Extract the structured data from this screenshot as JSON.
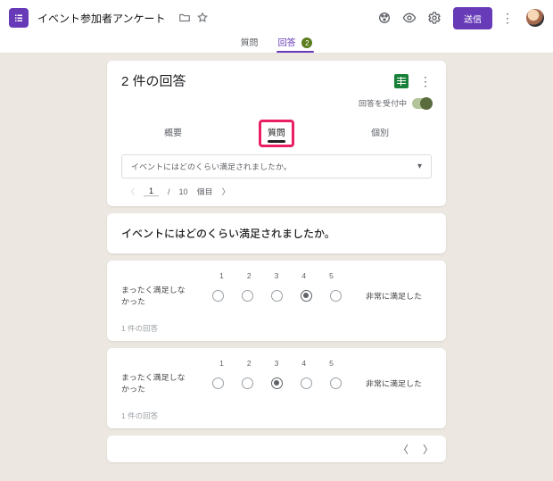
{
  "header": {
    "form_title": "イベント参加者アンケート",
    "send_label": "送信"
  },
  "top_tabs": {
    "questions": "質問",
    "responses": "回答",
    "responses_badge": "2"
  },
  "summary": {
    "title": "2 件の回答",
    "accepting_label": "回答を受付中",
    "inner_tabs": {
      "overview": "概要",
      "question": "質問",
      "individual": "個別"
    },
    "selector_text": "イベントにはどのくらい満足されましたか。",
    "pager": {
      "current": "1",
      "sep": "/",
      "total": "10",
      "unit": "個目"
    }
  },
  "question": {
    "title": "イベントにはどのくらい満足されましたか。"
  },
  "scale": {
    "numbers": [
      "1",
      "2",
      "3",
      "4",
      "5"
    ],
    "left_label": "まったく満足しなかった",
    "right_label": "非常に満足した",
    "footer": "1 件の回答"
  },
  "responses": [
    {
      "selected_index": 3
    },
    {
      "selected_index": 2
    }
  ]
}
